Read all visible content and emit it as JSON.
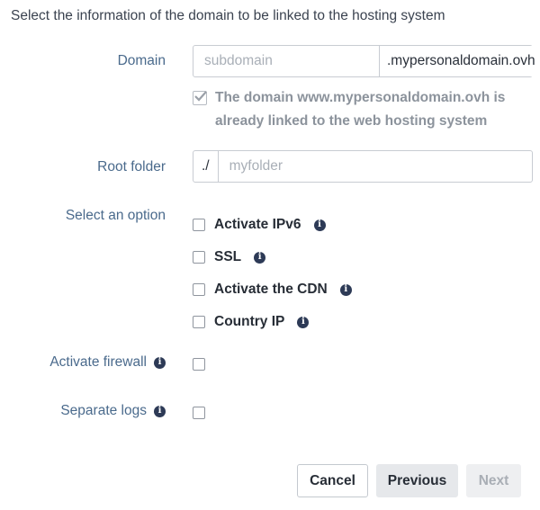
{
  "intro": "Select the information of the domain to be linked to the hosting system",
  "domain": {
    "label": "Domain",
    "placeholder": "subdomain",
    "suffix": ".mypersonaldomain.ovh",
    "linked_line1": "The domain www.mypersonaldomain.ovh is",
    "linked_line2": "already linked to the web hosting system"
  },
  "root": {
    "label": "Root folder",
    "prefix": "./",
    "placeholder": "myfolder"
  },
  "options": {
    "label": "Select an option",
    "items": [
      {
        "label": "Activate IPv6",
        "icon": "info-icon"
      },
      {
        "label": "SSL",
        "icon": "info-icon"
      },
      {
        "label": "Activate the CDN",
        "icon": "info-icon"
      },
      {
        "label": "Country IP",
        "icon": "info-icon"
      }
    ]
  },
  "firewall": {
    "label": "Activate firewall"
  },
  "logs": {
    "label": "Separate logs"
  },
  "buttons": {
    "cancel": "Cancel",
    "previous": "Previous",
    "next": "Next"
  },
  "info_glyph": "i",
  "colors": {
    "label": "#4a6a8c",
    "info_icon": "#2d3a56",
    "disabled_text": "#8c939c"
  }
}
